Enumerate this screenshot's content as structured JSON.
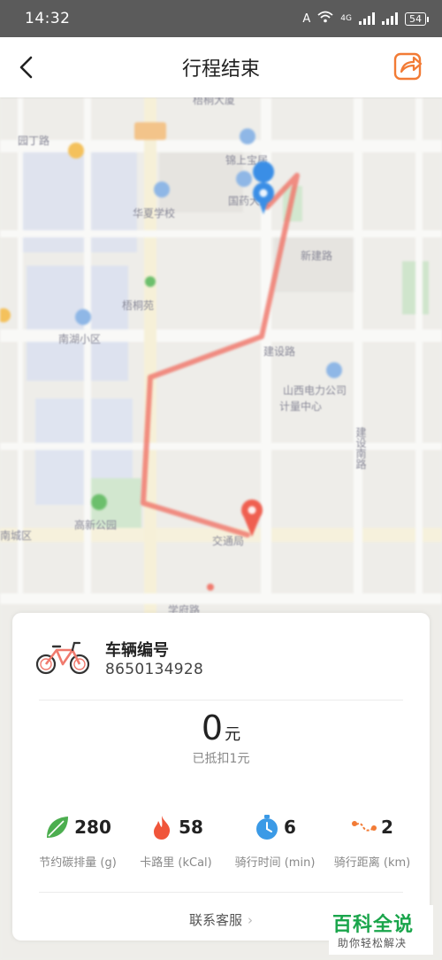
{
  "status_bar": {
    "time": "14:32",
    "network": "4G",
    "battery": "54"
  },
  "header": {
    "title": "行程结束"
  },
  "map": {
    "labels": [
      "梧桐大厦",
      "园丁路",
      "锦上宝居",
      "华夏学校",
      "国药大厦",
      "新建路",
      "梧桐苑",
      "南湖小区",
      "建设路",
      "山西电力公司",
      "计量中心",
      "建设南路",
      "高新公园",
      "交通局",
      "学府路",
      "南城区"
    ]
  },
  "card": {
    "vehicle_label": "车辆编号",
    "vehicle_number": "8650134928",
    "price": "0",
    "price_unit": "元",
    "discount_note": "已抵扣1元",
    "stats": [
      {
        "icon": "leaf-icon",
        "value": "280",
        "label": "节约碳排量 (g)"
      },
      {
        "icon": "flame-icon",
        "value": "58",
        "label": "卡路里 (kCal)"
      },
      {
        "icon": "stopwatch-icon",
        "value": "6",
        "label": "骑行时间 (min)"
      },
      {
        "icon": "route-icon",
        "value": "2",
        "label": "骑行距离 (km)"
      }
    ],
    "contact_label": "联系客服"
  },
  "watermark": {
    "title": "百科全说",
    "subtitle": "助你轻松解决"
  },
  "colors": {
    "route": "#f07a6e",
    "brand_orange": "#f27b35",
    "leaf": "#4cae4f",
    "flame": "#f0553a",
    "stopwatch": "#3b9ae6"
  }
}
